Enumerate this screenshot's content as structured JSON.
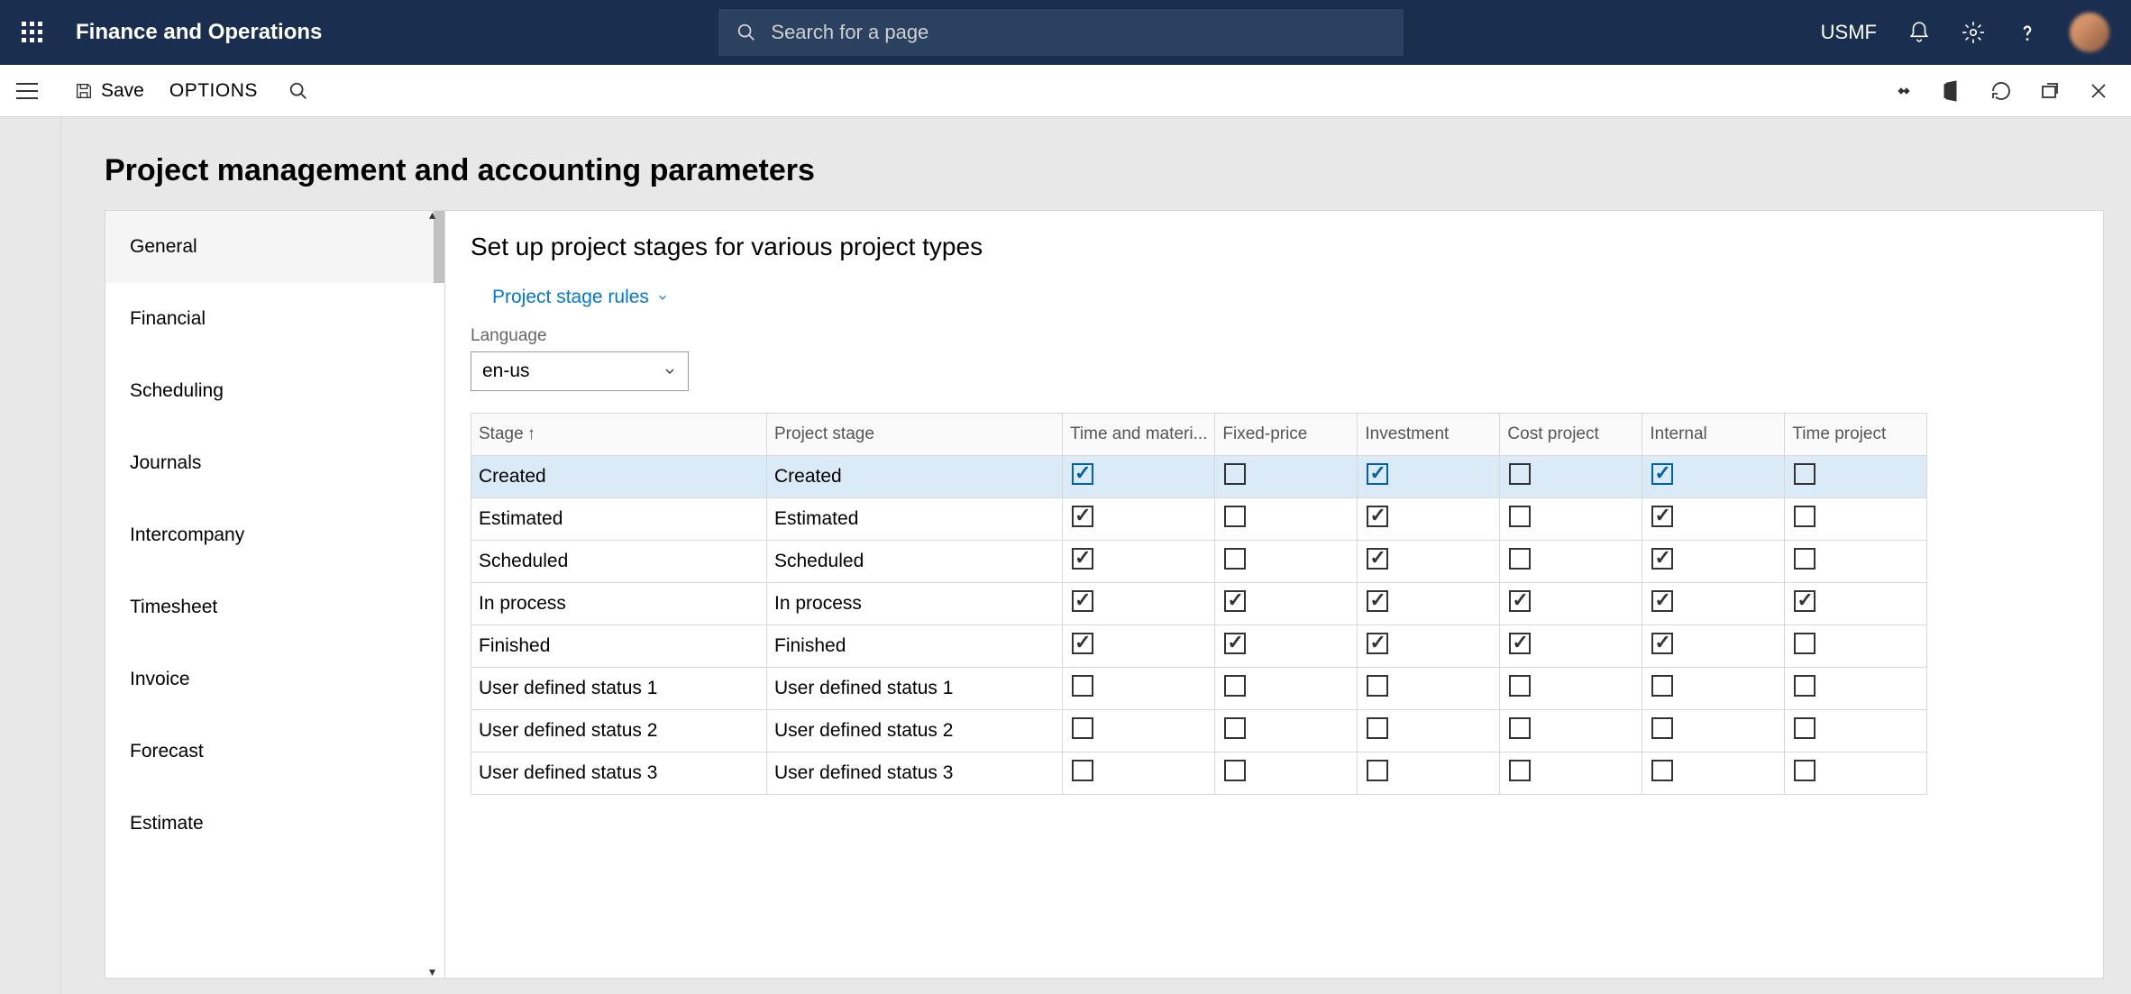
{
  "topbar": {
    "app_title": "Finance and Operations",
    "search_placeholder": "Search for a page",
    "company_code": "USMF"
  },
  "toolbar": {
    "save_label": "Save",
    "options_label": "OPTIONS"
  },
  "page": {
    "title": "Project management and accounting parameters"
  },
  "side_nav": {
    "items": [
      "General",
      "Financial",
      "Scheduling",
      "Journals",
      "Intercompany",
      "Timesheet",
      "Invoice",
      "Forecast",
      "Estimate"
    ],
    "selected_index": 0
  },
  "detail": {
    "title": "Set up project stages for various project types",
    "link_label": "Project stage rules",
    "language_label": "Language",
    "language_value": "en-us"
  },
  "table": {
    "columns": [
      "Stage",
      "Project stage",
      "Time and materi...",
      "Fixed-price",
      "Investment",
      "Cost project",
      "Internal",
      "Time project"
    ],
    "sort_col_index": 0,
    "rows": [
      {
        "stage": "Created",
        "project_stage": "Created",
        "tm": true,
        "fp": false,
        "inv": true,
        "cp": false,
        "int": true,
        "tp": false,
        "selected": true
      },
      {
        "stage": "Estimated",
        "project_stage": "Estimated",
        "tm": true,
        "fp": false,
        "inv": true,
        "cp": false,
        "int": true,
        "tp": false,
        "selected": false
      },
      {
        "stage": "Scheduled",
        "project_stage": "Scheduled",
        "tm": true,
        "fp": false,
        "inv": true,
        "cp": false,
        "int": true,
        "tp": false,
        "selected": false
      },
      {
        "stage": "In process",
        "project_stage": "In process",
        "tm": true,
        "fp": true,
        "inv": true,
        "cp": true,
        "int": true,
        "tp": true,
        "selected": false
      },
      {
        "stage": "Finished",
        "project_stage": "Finished",
        "tm": true,
        "fp": true,
        "inv": true,
        "cp": true,
        "int": true,
        "tp": false,
        "selected": false
      },
      {
        "stage": "User defined status 1",
        "project_stage": "User defined status 1",
        "tm": false,
        "fp": false,
        "inv": false,
        "cp": false,
        "int": false,
        "tp": false,
        "selected": false
      },
      {
        "stage": "User defined status 2",
        "project_stage": "User defined status 2",
        "tm": false,
        "fp": false,
        "inv": false,
        "cp": false,
        "int": false,
        "tp": false,
        "selected": false
      },
      {
        "stage": "User defined status 3",
        "project_stage": "User defined status 3",
        "tm": false,
        "fp": false,
        "inv": false,
        "cp": false,
        "int": false,
        "tp": false,
        "selected": false
      }
    ]
  }
}
